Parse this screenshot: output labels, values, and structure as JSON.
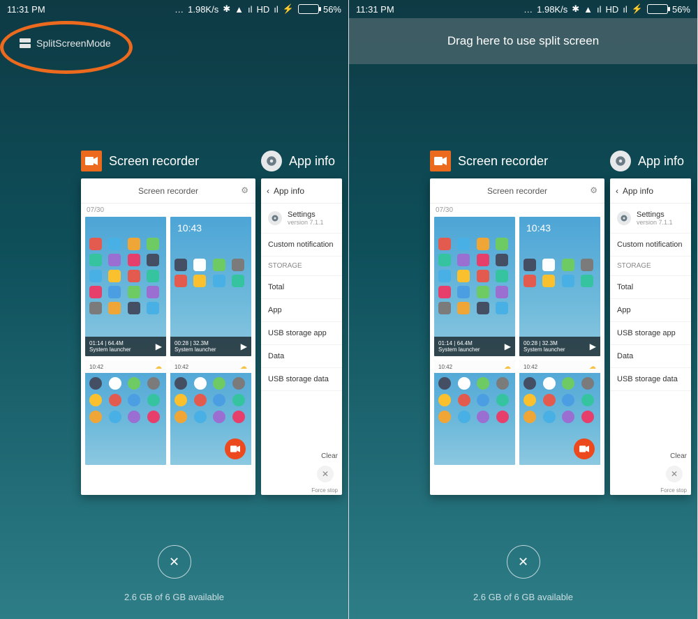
{
  "status": {
    "time": "11:31 PM",
    "speed": "1.98K/s",
    "hd": "HD",
    "battery_pct": "56%"
  },
  "left": {
    "split_label": "SplitScreenMode"
  },
  "right": {
    "drag_hint": "Drag here to use split screen"
  },
  "recents": {
    "card_a_title": "Screen recorder",
    "card_b_title": "App info",
    "sr": {
      "title": "Screen recorder",
      "date": "07/30",
      "thumbs": [
        {
          "time": "01:14",
          "size": "64.4M",
          "sub": "System launcher"
        },
        {
          "time": "00:28",
          "size": "32.3M",
          "sub": "System launcher"
        }
      ],
      "short_time": "10:42",
      "short_clock_big": "10:43"
    },
    "ai": {
      "header": "App info",
      "settings_name": "Settings",
      "settings_ver": "version 7.1.1",
      "rows": [
        "Custom notification",
        "STORAGE",
        "Total",
        "App",
        "USB storage app",
        "Data",
        "USB storage data"
      ],
      "clear": "Clear",
      "force_stop": "Force stop"
    }
  },
  "bottom": {
    "memory": "2.6 GB of 6 GB available"
  }
}
